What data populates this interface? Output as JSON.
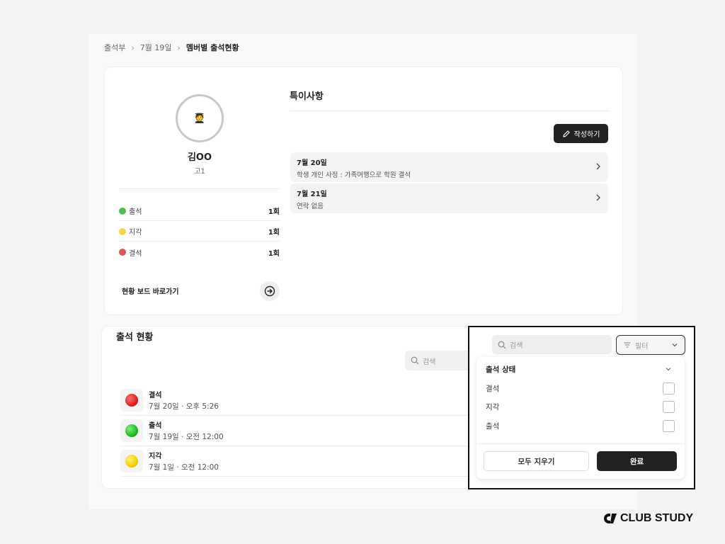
{
  "breadcrumb": {
    "items": [
      "출석부",
      "7월 19일",
      "멤버별 출석현황"
    ]
  },
  "profile": {
    "avatar_emoji": "🧑‍🎓",
    "name": "김OO",
    "grade": "고1",
    "stats": [
      {
        "label": "출석",
        "count": "1회",
        "color": "#4cc04c"
      },
      {
        "label": "지각",
        "count": "1회",
        "color": "#f5d547"
      },
      {
        "label": "결석",
        "count": "1회",
        "color": "#e05555"
      }
    ],
    "board_link": "현황 보드 바로가기"
  },
  "notes": {
    "title": "특이사항",
    "write_label": "작성하기",
    "items": [
      {
        "date": "7월 20일",
        "text": "학생 개인 사정 : 가족여행으로 학원 결석"
      },
      {
        "date": "7월 21일",
        "text": "연락 없음"
      }
    ]
  },
  "attendance": {
    "title": "출석 현황",
    "search_placeholder": "검색",
    "rows": [
      {
        "status": "결석",
        "when": "7월 20일 · 오후 5:26",
        "color": "#e02020"
      },
      {
        "status": "출석",
        "when": "7월 19일 · 오전 12:00",
        "color": "#22bb22"
      },
      {
        "status": "지각",
        "when": "7월 1일 · 오전 12:00",
        "color": "#f5d000"
      }
    ]
  },
  "filter_popup": {
    "search_placeholder": "검색",
    "filter_label": "필터",
    "section_title": "출석 상태",
    "options": [
      "결석",
      "지각",
      "출석"
    ],
    "clear_label": "모두 지우기",
    "done_label": "완료"
  },
  "brand": {
    "logo_text": "CLUB STUDY"
  }
}
